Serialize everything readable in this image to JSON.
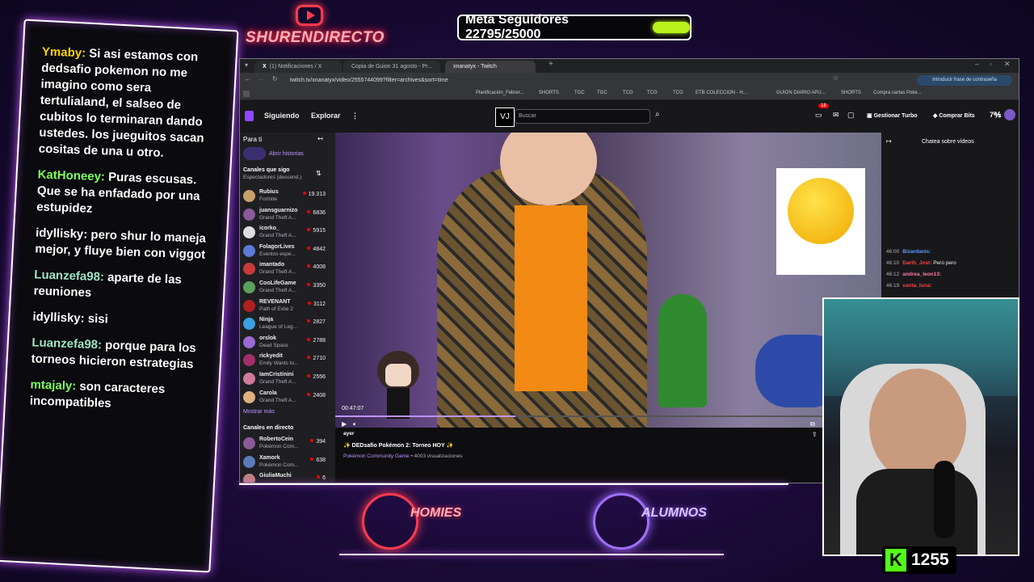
{
  "channel_logo": {
    "text": "SHURENDIRECTO"
  },
  "goal": {
    "text": "Meta Seguidores 22795/25000"
  },
  "chat": [
    {
      "user": "Ymaby:",
      "text": " Si asi estamos con dedsafio pokemon no me imagino como sera tertulialand, el salseo de cubitos lo terminaran dando ustedes. los jueguitos sacan cositas de una u otro.",
      "color": "#ffd400"
    },
    {
      "user": "KatHoneey:",
      "text": " Puras escusas. Que se ha enfadado por una estupidez",
      "color": "#7cff5c"
    },
    {
      "user": "idyllisky:",
      "text": " pero shur lo maneja mejor, y fluye bien con viggot",
      "color": "#ffffff"
    },
    {
      "user": "Luanzefa98:",
      "text": " aparte de las reuniones",
      "color": "#9ee6c8"
    },
    {
      "user": "idyllisky:",
      "text": " sisi",
      "color": "#ffffff"
    },
    {
      "user": "Luanzefa98:",
      "text": " porque para los torneos hicieron estrategias",
      "color": "#9ee6c8"
    },
    {
      "user": "mtajaly:",
      "text": " son caracteres incompatibles",
      "color": "#7cff5c"
    }
  ],
  "browser": {
    "tabs": [
      "(1) Notificaciones / X",
      "Copia de Guion 31 agosto - Pr...",
      "xnanatyx - Twitch"
    ],
    "url": "twitch.tv/xnanatyx/video/2555744099?filter=archives&sort=time",
    "password_prompt": "Introducir frase de contraseña",
    "bookmarks": [
      "Planificación_Febrer...",
      "SHORTS",
      "TGC",
      "TGC",
      "TCG",
      "TCG",
      "TCG",
      "ETB COLECCION - H...",
      "GUION DIARIO APU...",
      "SHORTS",
      "Compra cartas Poke..."
    ]
  },
  "twitch": {
    "nav_following": "Siguiendo",
    "nav_explore": "Explorar",
    "search_placeholder": "Buscar",
    "notif_count": "18",
    "manage_turbo": "Gestionar Turbo",
    "buy_bits": "Comprar Bits",
    "sidebar_title": "Para ti",
    "open_stories": "Abrir historias",
    "followed_title": "Canales que sigo",
    "followed_sub": "Espectadores (descend.)",
    "show_more": "Mostrar más",
    "live_title": "Canales en directo",
    "channels": [
      {
        "name": "Rubius",
        "game": "Fortnite",
        "viewers": "19.313",
        "color": "#c9a06a"
      },
      {
        "name": "juansguarnizo",
        "game": "Grand Theft A...",
        "viewers": "6836",
        "color": "#8a5a9a"
      },
      {
        "name": "icorko_",
        "game": "Grand Theft A...",
        "viewers": "5915",
        "color": "#ddd"
      },
      {
        "name": "FolagorLives",
        "game": "Eventos espe...",
        "viewers": "4842",
        "color": "#5b7bd6"
      },
      {
        "name": "imantado",
        "game": "Grand Theft A...",
        "viewers": "4008",
        "color": "#c73b3b"
      },
      {
        "name": "CooLifeGame",
        "game": "Grand Theft A...",
        "viewers": "3350",
        "color": "#5aa05a"
      },
      {
        "name": "REVENANT",
        "game": "Path of Exile 2",
        "viewers": "3112",
        "color": "#b02020"
      },
      {
        "name": "Ninja",
        "game": "League of Leg...",
        "viewers": "2827",
        "color": "#3aa0e0"
      },
      {
        "name": "orslok",
        "game": "Dead Space",
        "viewers": "2788",
        "color": "#9a6ad6"
      },
      {
        "name": "rickyedit",
        "game": "Emily Wants to...",
        "viewers": "2710",
        "color": "#a0306a"
      },
      {
        "name": "IamCristinini",
        "game": "Grand Theft A...",
        "viewers": "2556",
        "color": "#d07a9a"
      },
      {
        "name": "Carola",
        "game": "Grand Theft A...",
        "viewers": "2408",
        "color": "#e0b080"
      }
    ],
    "live_channels": [
      {
        "name": "RobertoCein",
        "game": "Pokémon Com...",
        "viewers": "394",
        "color": "#8a5a9a"
      },
      {
        "name": "Xamork",
        "game": "Pokémon Com...",
        "viewers": "638",
        "color": "#5a7aba"
      },
      {
        "name": "GiuliaMuchi",
        "game": "",
        "viewers": "6",
        "color": "#c08080"
      }
    ],
    "video_time": "00:47:07",
    "video_progress": 0.33,
    "video_date": "ayer",
    "video_title": "✨ DEDsafio Pokémon 2: Torneo HOY ✨",
    "video_game": "Pokémon Community Game",
    "video_views": " • 4003 visualizaciones",
    "chat_header": "Chatea sobre vídeos",
    "chat_replay": [
      {
        "time": "46:00",
        "user": "Bizardanis:",
        "text": "",
        "color": "#5b9bff"
      },
      {
        "time": "46:10",
        "user": "Darth_Jost:",
        "text": " Pero pero",
        "color": "#ff4040"
      },
      {
        "time": "46:12",
        "user": "andrea_leon13:",
        "text": "",
        "color": "#ff7aa0"
      },
      {
        "time": "46:19",
        "user": "vanta_luna:",
        "text": "",
        "color": "#ff4040"
      }
    ]
  },
  "overlay_logos": {
    "left": "HOMIES",
    "right": "ALUMNOS"
  },
  "kick": {
    "letter": "K",
    "count": "1255"
  }
}
